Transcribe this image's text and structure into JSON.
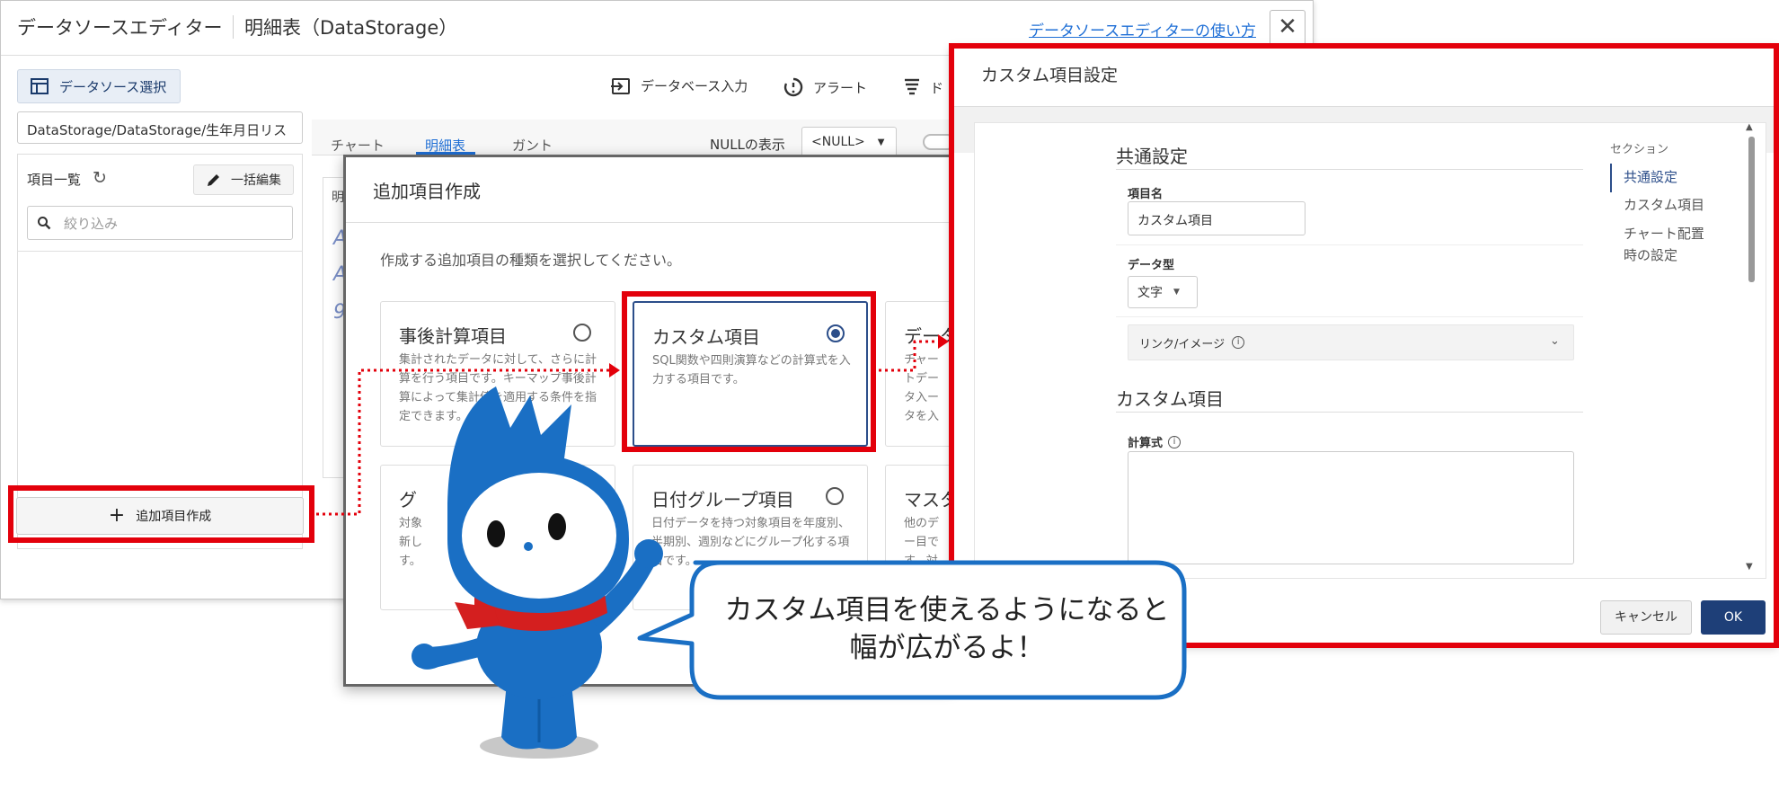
{
  "editor": {
    "title": "データソースエディター",
    "subtitle": "明細表（DataStorage）",
    "help_link": "データソースエディターの使い方",
    "close_glyph": "✕",
    "datasource_button": "データソース選択",
    "toolbar": {
      "db_input": "データベース入力",
      "alert": "アラート",
      "truncated_item": "ド"
    },
    "path": "DataStorage/DataStorage/生年月日リス",
    "items_title": "項目一覧",
    "bulk_edit": "一括編集",
    "filter_placeholder": "絞り込み",
    "add_item_button": "追加項目作成",
    "tabs": [
      "チャート",
      "明細表",
      "ガント"
    ],
    "active_tab": "明細表",
    "null_label": "NULLの表示",
    "null_value": "<NULL>",
    "preview_header": "明",
    "preview_glyphs": [
      "A",
      "A",
      "9"
    ]
  },
  "add_dialog": {
    "title": "追加項目作成",
    "prompt": "作成する追加項目の種類を選択してください。",
    "cards": [
      {
        "title": "事後計算項目",
        "desc": "集計されたデータに対して、さらに計算を行う項目です。キーマップ事後計算によって集計値を適用する条件を指定できます。",
        "selected": false
      },
      {
        "title": "カスタム項目",
        "desc": "SQL関数や四則演算などの計算式を入力する項目です。",
        "selected": true
      },
      {
        "title": "データ",
        "desc": "チャートデータ入ータを入",
        "selected": false
      },
      {
        "title": "グ",
        "desc": "対象新しす。",
        "selected": false
      },
      {
        "title": "日付グループ項目",
        "desc": "日付データを持つ対象項目を年度別、半期別、週別などにグループ化する項目です。",
        "selected": false
      },
      {
        "title": "マスタ",
        "desc": "他のデー目です。対応が定",
        "selected": false
      }
    ]
  },
  "custom_panel": {
    "title": "カスタム項目設定",
    "section_common": "共通設定",
    "item_name_label": "項目名",
    "item_name_value": "カスタム項目",
    "data_type_label": "データ型",
    "data_type_value": "文字",
    "link_image_label": "リンク/イメージ",
    "section_custom": "カスタム項目",
    "formula_label": "計算式",
    "toc": {
      "header": "セクション",
      "items": [
        "共通設定",
        "カスタム項目",
        "チャート配置時の設定"
      ],
      "active": "共通設定"
    },
    "cancel": "キャンセル",
    "ok": "OK"
  },
  "speech_bubble": {
    "line1": "カスタム項目を使えるようになると",
    "line2": "幅が広がるよ！"
  },
  "colors": {
    "highlight": "#e3000b",
    "link": "#1f6fd6",
    "primary": "#1e3f78",
    "mascot_blue": "#1a6fc4",
    "scarf_red": "#d41f1f",
    "bubble_border": "#1a6fc4"
  },
  "icons": {
    "close": "close-icon",
    "datasource": "table-icon",
    "db_input": "login-arrow-icon",
    "alert": "alert-clock-icon",
    "refresh": "refresh-icon",
    "edit": "pencil-icon",
    "search": "search-icon",
    "add": "plus-icon",
    "info": "info-icon",
    "chevron": "chevron-down-icon"
  }
}
